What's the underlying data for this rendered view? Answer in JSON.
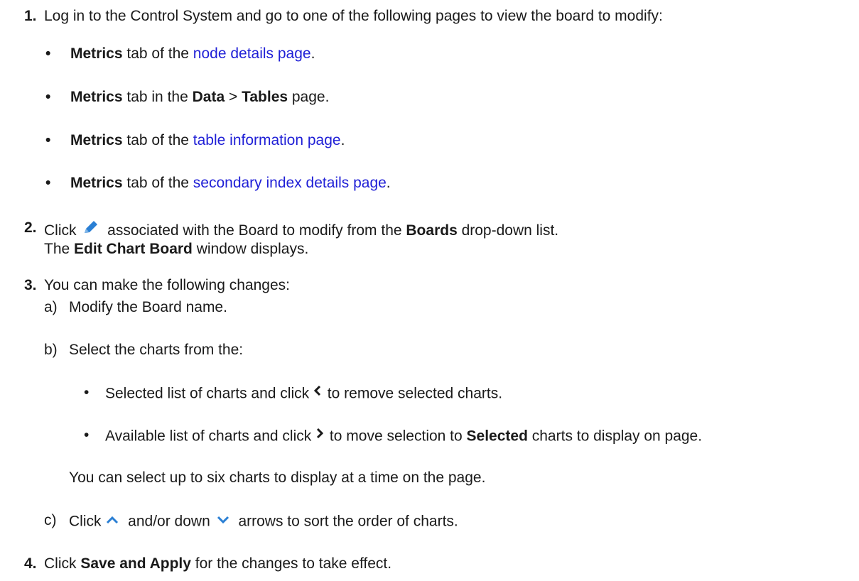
{
  "steps": [
    {
      "number": "1.",
      "text": "Log in to the Control System and go to one of the following pages to view the board to modify:",
      "bullets": [
        {
          "bold": "Metrics",
          "pre": " tab of the ",
          "link": "node details page",
          "post": "."
        },
        {
          "bold": "Metrics",
          "pre": " tab in the ",
          "bold2": "Data",
          "sep": " > ",
          "bold3": "Tables",
          "post": " page."
        },
        {
          "bold": "Metrics",
          "pre": " tab of the ",
          "link": "table information page",
          "post": "."
        },
        {
          "bold": "Metrics",
          "pre": " tab of the ",
          "link": "secondary index details page",
          "post": "."
        }
      ]
    },
    {
      "number": "2.",
      "click": "Click ",
      "after_icon": " associated with the Board to modify from the ",
      "bold": "Boards",
      "after_bold": " drop-down list.",
      "line2_pre": "The ",
      "line2_bold": "Edit Chart Board",
      "line2_post": " window displays."
    },
    {
      "number": "3.",
      "text": "You can make the following changes:",
      "a": {
        "letter": "a)",
        "text": "Modify the Board name."
      },
      "b": {
        "letter": "b)",
        "text": "Select the charts from the:",
        "items": [
          {
            "pre": "Selected list of charts and click ",
            "post": " to remove selected charts."
          },
          {
            "pre": "Available list of charts and click ",
            "mid": " to move selection to ",
            "bold": "Selected",
            "post": " charts to display on page."
          }
        ],
        "note": "You can select up to six charts to display at a time on the page."
      },
      "c": {
        "letter": "c)",
        "pre": "Click ",
        "mid": " and/or down ",
        "post": " arrows to sort the order of charts."
      }
    },
    {
      "number": "4.",
      "pre": "Click ",
      "bold": "Save and Apply",
      "post": " for the changes to take effect."
    }
  ],
  "icons": {
    "edit": "pencil-icon",
    "remove": "chevron-left-icon",
    "add": "chevron-right-icon",
    "up": "chevron-up-icon",
    "down": "chevron-down-icon"
  },
  "colors": {
    "link": "#1f1fd6",
    "icon": "#2a7fd4"
  }
}
